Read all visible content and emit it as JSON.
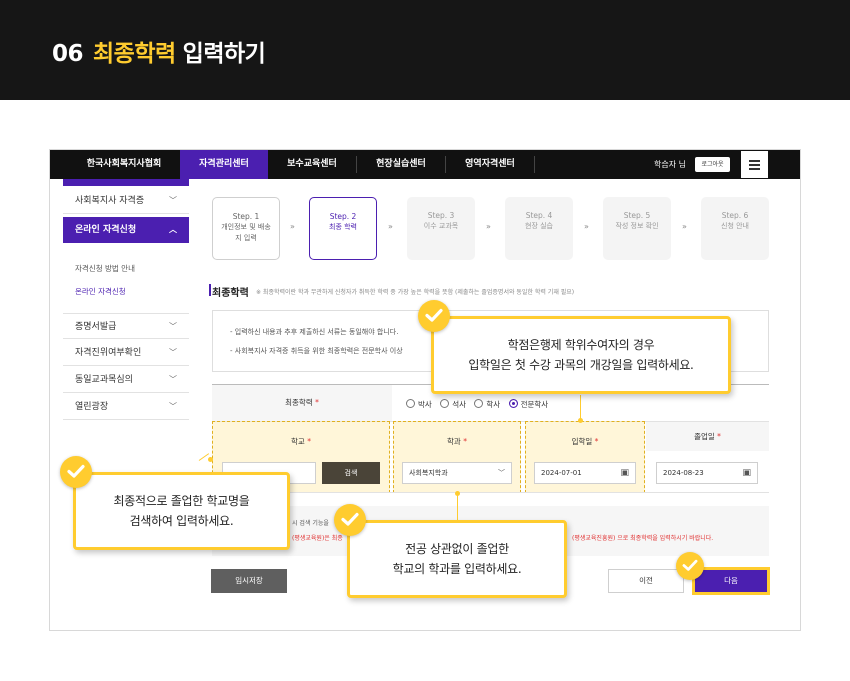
{
  "banner": {
    "number": "06",
    "highlight": "최종학력",
    "rest": "입력하기"
  },
  "topnav": {
    "items": [
      "한국사회복지사협회",
      "자격관리센터",
      "보수교육센터",
      "현장실습센터",
      "영역자격센터"
    ],
    "active": "자격관리센터",
    "user": "학습자 님",
    "logout": "로그아웃",
    "menu_icon": "hamburger-icon"
  },
  "sidebar": {
    "items": [
      {
        "label": "사회복지사 자격증"
      },
      {
        "label": "온라인 자격신청"
      },
      {
        "label": "증명서발급"
      },
      {
        "label": "자격진위여부확인"
      },
      {
        "label": "동일교과목심의"
      },
      {
        "label": "열린광장"
      }
    ],
    "subitems": [
      "자격신청 방법 안내",
      "온라인 자격신청"
    ]
  },
  "steps": [
    {
      "no": "Step. 1",
      "label": "개인정보 및 배송지 입력"
    },
    {
      "no": "Step. 2",
      "label": "최종 학력"
    },
    {
      "no": "Step. 3",
      "label": "이수 교과목"
    },
    {
      "no": "Step. 4",
      "label": "현장 실습"
    },
    {
      "no": "Step. 5",
      "label": "작성 정보 확인"
    },
    {
      "no": "Step. 6",
      "label": "신청 안내"
    }
  ],
  "section": {
    "title": "최종학력",
    "note": "※ 최종학력이란 학과 무관하게 신청자가 취득한 학력 중 가장 높은 학력을 뜻함 (제출하는 졸업증명서와 동일한 학력 기재 필요)"
  },
  "notice": {
    "line1": "- 입력하신 내용과 추후 제출하신 서류는 동일해야 합니다.",
    "line2": "- 사회복지사 자격증 취득을 위한 최종학력은 전문학사 이상"
  },
  "form": {
    "degree_label": "최종학력",
    "required_mark": "*",
    "degree_options": [
      "박사",
      "석사",
      "학사",
      "전문학사"
    ],
    "degree_selected": "전문학사",
    "school_label": "학교",
    "dept_label": "학과",
    "entry_label": "입학일",
    "grad_label": "졸업일",
    "search_button": "검색",
    "dept_value": "사회복지학과",
    "entry_value": "2024-07-01",
    "grad_value": "2024-08-23"
  },
  "warning": {
    "line1": "시 검색 기능을",
    "line2_red": "(평생교육원)은 최종",
    "line2_right": "(평생교육진흥원) 으로 최종학력을 입력하시기 바랍니다."
  },
  "buttons": {
    "temp_save": "임시저장",
    "prev": "이전",
    "next": "다음"
  },
  "callouts": {
    "top": {
      "line1": "학점은행제 학위수여자의 경우",
      "line2": "입학일은 첫 수강 과목의 개강일을 입력하세요."
    },
    "left": {
      "line1": "최종적으로 졸업한 학교명을",
      "line2": "검색하여 입력하세요."
    },
    "mid": {
      "line1": "전공 상관없이 졸업한",
      "line2": "학교의 학과를 입력하세요."
    }
  },
  "colors": {
    "accent": "#4b1fb0",
    "highlight": "#ffcc2f",
    "banner_bg": "#161616"
  }
}
